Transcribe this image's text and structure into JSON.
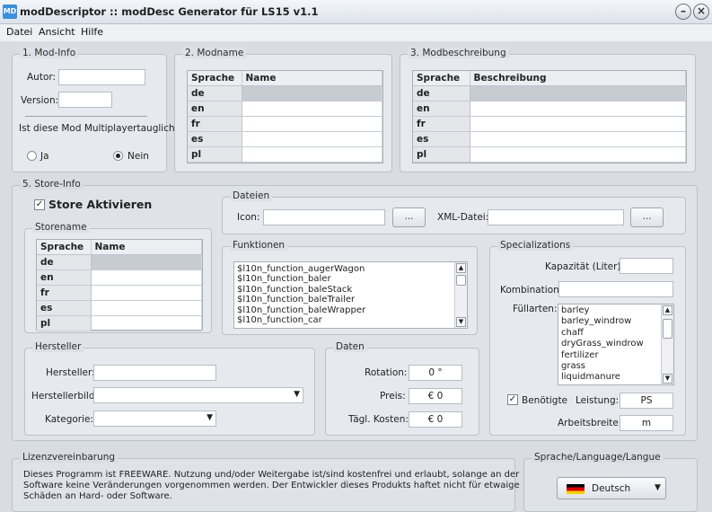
{
  "window": {
    "title": "modDescriptor :: modDesc Generator für LS15 v1.1",
    "icon": "app-icon",
    "minimize_label": "–",
    "close_label": "×"
  },
  "menu": [
    "Datei",
    "Ansicht",
    "Hilfe"
  ],
  "modinfo": {
    "title": "1. Mod-Info",
    "autor_label": "Autor:",
    "autor_value": "",
    "version_label": "Version:",
    "version_value": "",
    "mp_question": "Ist diese Mod Multiplayertauglich?",
    "radio_ja": "Ja",
    "radio_nein": "Nein",
    "selected": "Nein"
  },
  "modname": {
    "title": "2. Modname",
    "col_lang": "Sprache",
    "col_value": "Name",
    "rows": [
      "de",
      "en",
      "fr",
      "es",
      "pl"
    ]
  },
  "modbeschreibung": {
    "title": "3. Modbeschreibung",
    "col_lang": "Sprache",
    "col_value": "Beschreibung",
    "rows": [
      "de",
      "en",
      "fr",
      "es",
      "pl"
    ]
  },
  "storeinfo": {
    "title": "5. Store-Info",
    "activate_label": "Store Aktivieren",
    "activate_checked": true
  },
  "storename": {
    "title": "Storename",
    "col_lang": "Sprache",
    "col_value": "Name",
    "rows": [
      "de",
      "en",
      "fr",
      "es",
      "pl"
    ]
  },
  "dateien": {
    "title": "Dateien",
    "icon_label": "Icon:",
    "icon_value": "",
    "browse_label": "...",
    "xml_label": "XML-Datei:",
    "xml_value": ""
  },
  "funktionen": {
    "title": "Funktionen",
    "items": [
      "$l10n_function_augerWagon",
      "$l10n_function_baler",
      "$l10n_function_baleStack",
      "$l10n_function_baleTrailer",
      "$l10n_function_baleWrapper",
      "$l10n_function_car"
    ]
  },
  "specializations": {
    "title": "Specializations",
    "kapazitaet_label": "Kapazität (Liter):",
    "kapazitaet_value": "",
    "kombination_label": "Kombination:",
    "kombination_value": "",
    "fuellarten_label": "Füllarten:",
    "fuellarten": [
      "barley",
      "barley_windrow",
      "chaff",
      "dryGrass_windrow",
      "fertilizer",
      "grass",
      "liquidmanure"
    ],
    "benoetigte_label": "Benötigte",
    "benoetigte_checked": true,
    "leistung_label": "Leistung:",
    "leistung_value": "PS",
    "arbeitsbreite_label": "Arbeitsbreite:",
    "arbeitsbreite_value": "m"
  },
  "hersteller": {
    "title": "Hersteller",
    "hersteller_label": "Hersteller:",
    "hersteller_value": "",
    "herstellerbild_label": "Herstellerbild:",
    "herstellerbild_value": "",
    "kategorie_label": "Kategorie:",
    "kategorie_value": ""
  },
  "daten": {
    "title": "Daten",
    "rotation_label": "Rotation:",
    "rotation_value": "0 °",
    "preis_label": "Preis:",
    "preis_value": "€ 0",
    "kosten_label": "Tägl. Kosten:",
    "kosten_value": "€ 0"
  },
  "lizenz": {
    "title": "Lizenzvereinbarung",
    "line1": "Dieses Programm ist FREEWARE. Nutzung und/oder Weitergabe ist/sind kostenfrei und erlaubt, solange an der",
    "line2": "Software keine Veränderungen vorgenommen werden. Der Entwickler dieses Produkts haftet nicht für etwaige",
    "line3": "Schäden an Hard- oder Software."
  },
  "sprache": {
    "title": "Sprache/Language/Langue",
    "selected": "Deutsch"
  },
  "colors": {
    "accent": "#3c8fd8",
    "background": "#d9dce2",
    "selection": "#c7cbd2"
  }
}
